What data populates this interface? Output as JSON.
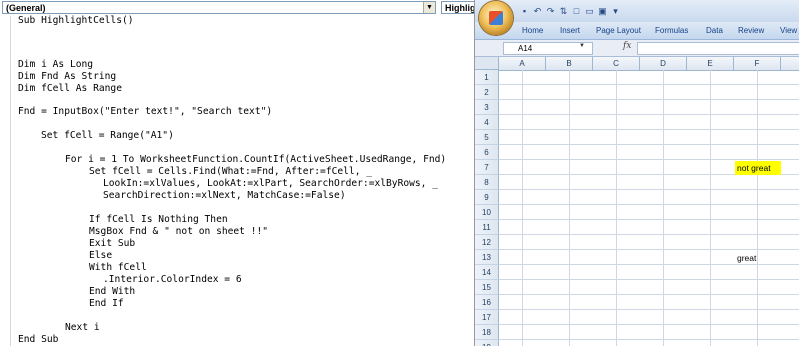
{
  "vba_editor": {
    "object_dropdown": "(General)",
    "procedure_dropdown": "HighlightCells",
    "code_lines": [
      {
        "text": "Sub HighlightCells()",
        "indent": 0
      },
      {
        "text": "Dim i As Long",
        "indent": 0
      },
      {
        "text": "Dim Fnd As String",
        "indent": 0
      },
      {
        "text": "Dim fCell As Range",
        "indent": 0
      },
      {
        "text": "Fnd = InputBox(\"Enter text!\", \"Search text\")",
        "indent": 0
      },
      {
        "text": "Set fCell = Range(\"A1\")",
        "indent": 1
      },
      {
        "text": "For i = 1 To WorksheetFunction.CountIf(ActiveSheet.UsedRange, Fnd)",
        "indent": 2
      },
      {
        "text": "Set fCell = Cells.Find(What:=Fnd, After:=fCell, _",
        "indent": 3
      },
      {
        "text": "LookIn:=xlValues, LookAt:=xlPart, SearchOrder:=xlByRows, _",
        "indent": 4
      },
      {
        "text": "SearchDirection:=xlNext, MatchCase:=False)",
        "indent": 4
      },
      {
        "text": "If fCell Is Nothing Then",
        "indent": 3
      },
      {
        "text": "MsgBox Fnd & \" not on sheet !!\"",
        "indent": 3
      },
      {
        "text": "Exit Sub",
        "indent": 3
      },
      {
        "text": "Else",
        "indent": 3
      },
      {
        "text": "With fCell",
        "indent": 3
      },
      {
        "text": ".Interior.ColorIndex = 6",
        "indent": 4
      },
      {
        "text": "End With",
        "indent": 3
      },
      {
        "text": "End If",
        "indent": 3
      },
      {
        "text": "Next i",
        "indent": 2
      },
      {
        "text": "End Sub",
        "indent": 0
      }
    ]
  },
  "excel": {
    "qat_icons": [
      "save-icon",
      "undo-icon",
      "redo-icon",
      "sort-icon",
      "new-icon",
      "open-icon",
      "quick-print-icon",
      "customize-icon"
    ],
    "tabs": [
      "Home",
      "Insert",
      "Page Layout",
      "Formulas",
      "Data",
      "Review",
      "View"
    ],
    "name_box": "A14",
    "fx_label": "fx",
    "formula_value": "",
    "columns": [
      "A",
      "B",
      "C",
      "D",
      "E",
      "F"
    ],
    "rows": [
      "1",
      "2",
      "3",
      "4",
      "5",
      "6",
      "7",
      "8",
      "9",
      "10",
      "11",
      "12",
      "13",
      "14",
      "15",
      "16",
      "17",
      "18",
      "19"
    ],
    "cells": [
      {
        "ref": "F7",
        "value": "not great",
        "fill": "#ffff00"
      },
      {
        "ref": "F13",
        "value": "great",
        "fill": ""
      }
    ]
  }
}
